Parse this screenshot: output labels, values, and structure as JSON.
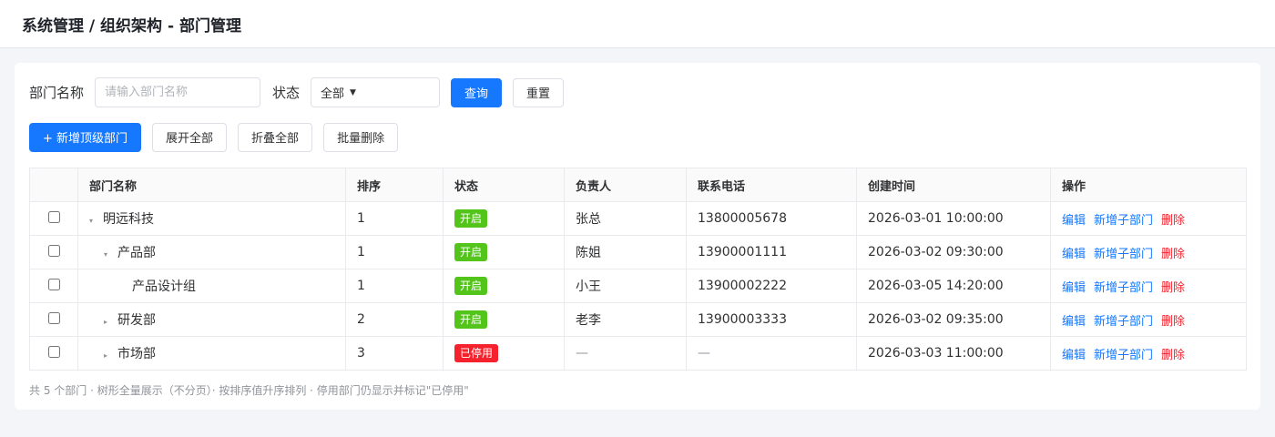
{
  "page": {
    "title": "系统管理 / 组织架构 - 部门管理"
  },
  "search": {
    "name_label": "部门名称",
    "name_placeholder": "请输入部门名称",
    "status_label": "状态",
    "status_value": "全部",
    "query_label": "查询",
    "reset_label": "重置"
  },
  "toolbar": {
    "add_top_label": "+ 新增顶级部门",
    "expand_all_label": "展开全部",
    "collapse_all_label": "折叠全部",
    "batch_delete_label": "批量删除"
  },
  "table": {
    "headers": [
      "部门名称",
      "排序",
      "状态",
      "负责人",
      "联系电话",
      "创建时间",
      "操作"
    ],
    "rows": [
      {
        "name": "明远科技",
        "level": 0,
        "toggle": "▾",
        "sort": "1",
        "status": "开启",
        "leader": "张总",
        "phone": "13800005678",
        "created": "2026-03-01 10:00:00"
      },
      {
        "name": "产品部",
        "level": 1,
        "toggle": "▾",
        "sort": "1",
        "status": "开启",
        "leader": "陈姐",
        "phone": "13900001111",
        "created": "2026-03-02 09:30:00"
      },
      {
        "name": "产品设计组",
        "level": 2,
        "toggle": "",
        "sort": "1",
        "status": "开启",
        "leader": "小王",
        "phone": "13900002222",
        "created": "2026-03-05 14:20:00"
      },
      {
        "name": "研发部",
        "level": 1,
        "toggle": "▸",
        "sort": "2",
        "status": "开启",
        "leader": "老李",
        "phone": "13900003333",
        "created": "2026-03-02 09:35:00"
      },
      {
        "name": "市场部",
        "level": 1,
        "toggle": "▸",
        "sort": "3",
        "status": "已停用",
        "leader": "—",
        "phone": "—",
        "created": "2026-03-03 11:00:00"
      }
    ],
    "actions": {
      "edit": "编辑",
      "add_child": "新增子部门",
      "delete": "删除"
    }
  },
  "status_colors": {
    "开启": "#52c41a",
    "已停用": "#f5222d"
  },
  "footnote": "共 5 个部门 · 树形全量展示（不分页）· 按排序值升序排列 · 停用部门仍显示并标记\"已停用\""
}
